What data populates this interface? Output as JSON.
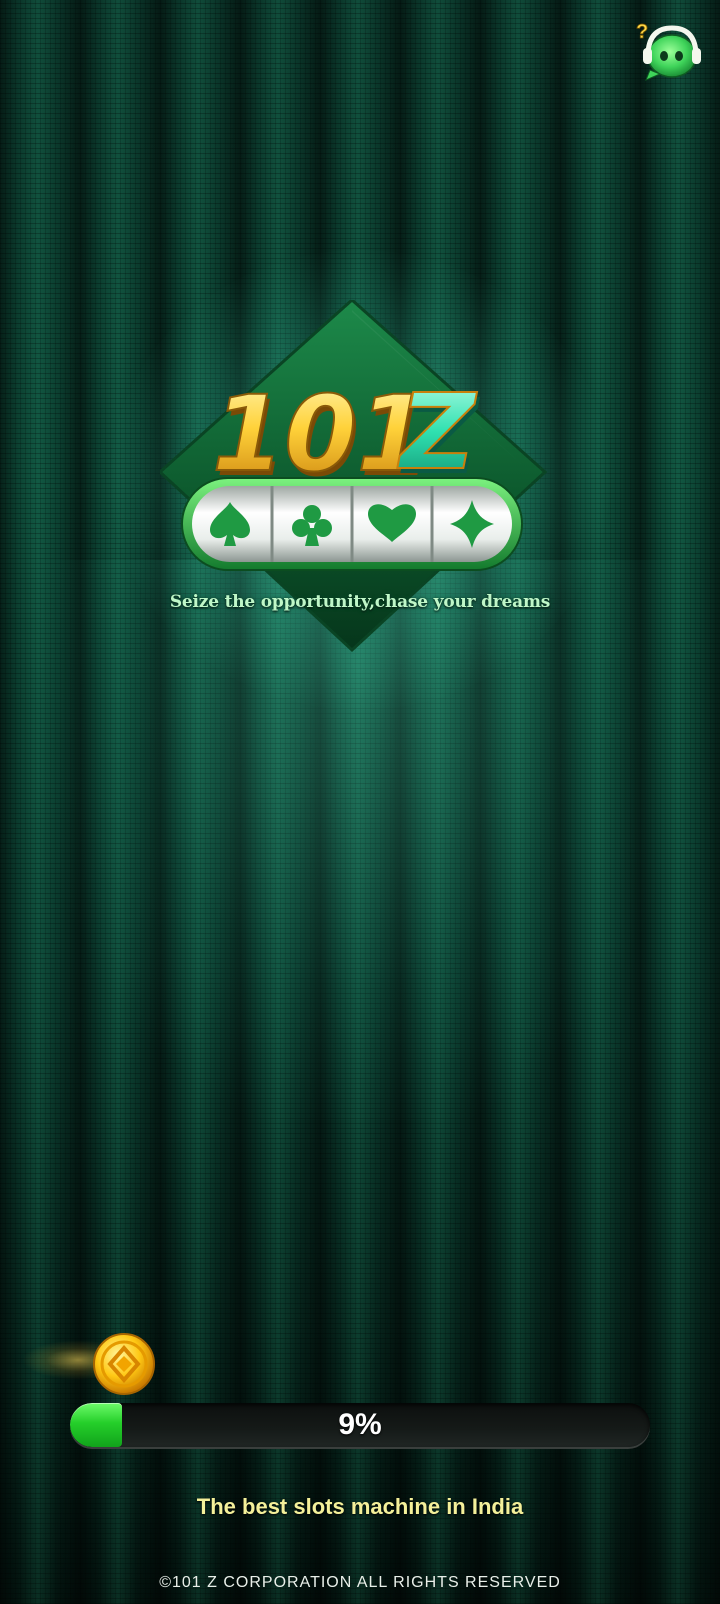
{
  "app": {
    "logo_text_numeric": "101",
    "logo_text_letter": "Z",
    "tagline": "Seize the opportunity,chase your dreams"
  },
  "header": {
    "support_icon": "customer-support-headset-icon"
  },
  "reels": {
    "symbols": [
      "spade",
      "club",
      "heart",
      "diamond"
    ]
  },
  "loading": {
    "progress_value": 0.09,
    "progress_label": "9%",
    "coin_icon": "gold-coin-icon"
  },
  "footer": {
    "subtitle": "The best slots machine in India",
    "copyright": "©101 Z CORPORATION ALL RIGHTS RESERVED"
  },
  "colors": {
    "background": "#0b3f31",
    "progress_fill": "#25cf2a",
    "subtitle_text": "#f4f09a",
    "tagline_text": "#bff7c8"
  }
}
